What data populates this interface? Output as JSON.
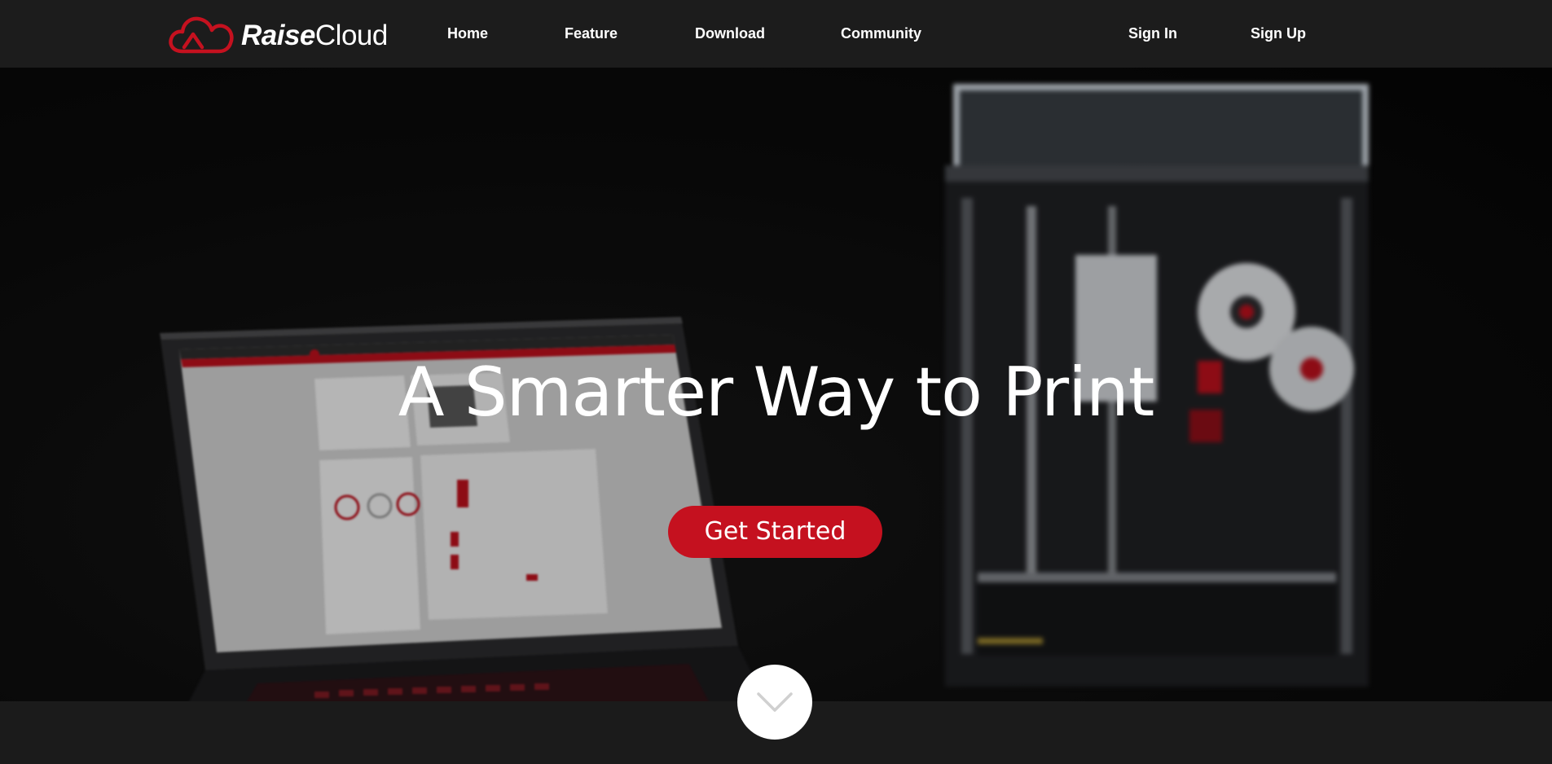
{
  "brand": {
    "name_part1": "Raise",
    "name_part2": "Cloud",
    "accent": "#c5111f",
    "logo_icon": "cloud-logo-icon"
  },
  "nav": {
    "items": [
      {
        "label": "Home"
      },
      {
        "label": "Feature"
      },
      {
        "label": "Download"
      },
      {
        "label": "Community"
      }
    ],
    "sign_in": "Sign In",
    "sign_up": "Sign Up"
  },
  "hero": {
    "title": "A Smarter Way to Print",
    "cta_label": "Get Started",
    "scroll_icon": "chevron-down-icon"
  },
  "colors": {
    "nav_bg": "#1c1c1c",
    "cta_bg": "#c5111f",
    "page_bg": "#1b1b1b"
  }
}
